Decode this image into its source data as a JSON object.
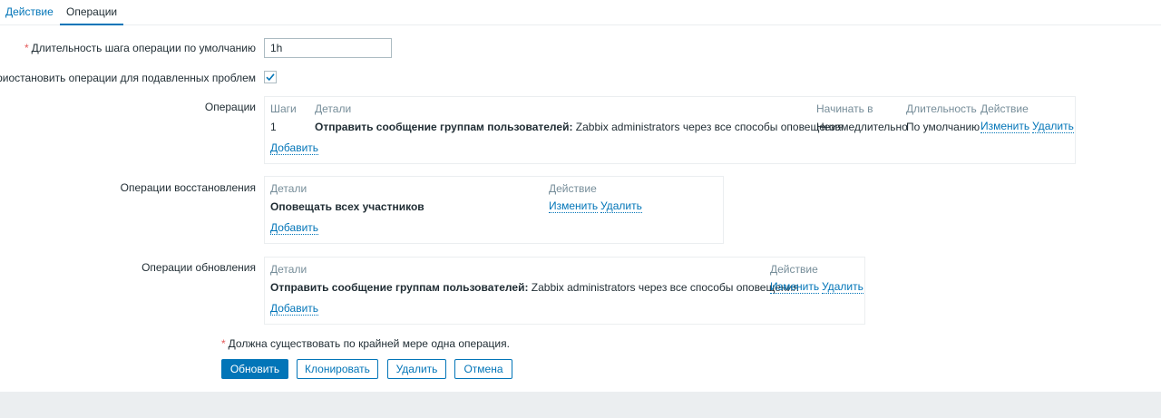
{
  "tabs": {
    "action": "Действие",
    "operations": "Операции"
  },
  "form": {
    "step_duration": {
      "label": "Длительность шага операции по умолчанию",
      "value": "1h"
    },
    "pause_suppressed": {
      "label": "Приостановить операции для подавленных проблем",
      "checked": true
    },
    "operations": {
      "label": "Операции",
      "headers": {
        "steps": "Шаги",
        "details": "Детали",
        "start_in": "Начинать в",
        "duration": "Длительность",
        "action": "Действие"
      },
      "row": {
        "step": "1",
        "details_bold": "Отправить сообщение группам пользователей:",
        "details_rest": " Zabbix administrators через все способы оповещения",
        "start_in": "Незамедлительно",
        "duration": "По умолчанию",
        "edit": "Изменить",
        "remove": "Удалить"
      },
      "add": "Добавить"
    },
    "recovery_operations": {
      "label": "Операции восстановления",
      "headers": {
        "details": "Детали",
        "action": "Действие"
      },
      "row": {
        "details_bold": "Оповещать всех участников",
        "edit": "Изменить",
        "remove": "Удалить"
      },
      "add": "Добавить"
    },
    "update_operations": {
      "label": "Операции обновления",
      "headers": {
        "details": "Детали",
        "action": "Действие"
      },
      "row": {
        "details_bold": "Отправить сообщение группам пользователей:",
        "details_rest": " Zabbix administrators через все способы оповещения",
        "edit": "Изменить",
        "remove": "Удалить"
      },
      "add": "Добавить"
    },
    "required_note": "Должна существовать по крайней мере одна операция."
  },
  "buttons": {
    "update": "Обновить",
    "clone": "Клонировать",
    "delete": "Удалить",
    "cancel": "Отмена"
  },
  "colors": {
    "accent": "#0275b8",
    "required": "#e45959",
    "header_text": "#768d99",
    "border": "#ebeef0"
  },
  "icons": {
    "checkbox": "checkmark-icon"
  }
}
